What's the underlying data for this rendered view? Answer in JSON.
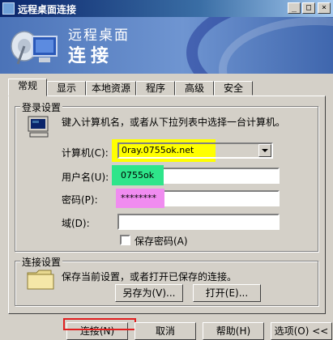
{
  "window": {
    "title": "远程桌面连接"
  },
  "titlebar_buttons": {
    "minimize": "_",
    "maximize": "□",
    "close": "×"
  },
  "banner": {
    "line1": "远程桌面",
    "line2": "连接"
  },
  "tabs": [
    {
      "label": "常规"
    },
    {
      "label": "显示"
    },
    {
      "label": "本地资源"
    },
    {
      "label": "程序"
    },
    {
      "label": "高级"
    },
    {
      "label": "安全"
    }
  ],
  "login": {
    "group_label": "登录设置",
    "instruction": "键入计算机名，或者从下拉列表中选择一台计算机。",
    "computer_label": "计算机(C):",
    "computer_value": "0ray.0755ok.net",
    "username_label": "用户名(U):",
    "username_value": "0755ok",
    "password_label": "密码(P):",
    "password_value": "********",
    "domain_label": "域(D):",
    "domain_value": "",
    "save_password_label": "保存密码(A)"
  },
  "connection": {
    "group_label": "连接设置",
    "text": "保存当前设置，或者打开已保存的连接。",
    "save_as_label": "另存为(V)...",
    "open_label": "打开(E)..."
  },
  "bottom_buttons": {
    "connect": "连接(N)",
    "cancel": "取消",
    "help": "帮助(H)",
    "options": "选项(O) <<"
  }
}
